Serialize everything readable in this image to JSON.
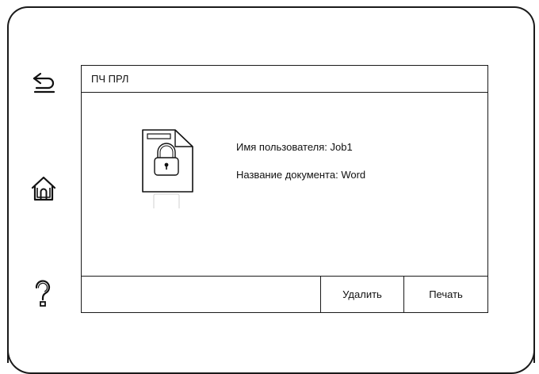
{
  "side_buttons": [
    {
      "icon": "back-arrow-icon"
    },
    {
      "icon": "home-icon"
    },
    {
      "icon": "question-mark-icon"
    }
  ],
  "screen": {
    "title": "ПЧ ПРЛ",
    "document_icon": "locked-document-icon",
    "info": {
      "user_name": "Имя пользователя: Job1",
      "document_name": "Название документа: Word"
    },
    "actions": {
      "delete_label": "Удалить",
      "print_label": "Печать"
    }
  }
}
